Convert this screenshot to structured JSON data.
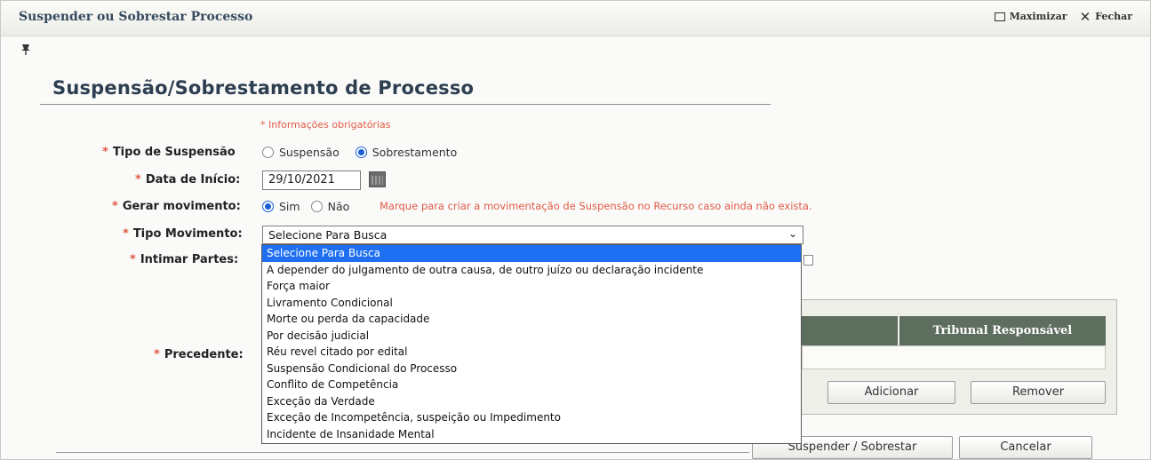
{
  "window": {
    "title": "Suspender ou Sobrestar Processo",
    "maximize_label": "Maximizar",
    "close_label": "Fechar"
  },
  "form": {
    "heading": "Suspensão/Sobrestamento de Processo",
    "required_note": "* Informações obrigatórias",
    "required_mark": "*",
    "tipo_suspensao": {
      "label": "Tipo de Suspensão",
      "options": [
        "Suspensão",
        "Sobrestamento"
      ],
      "selected": "Sobrestamento"
    },
    "data_inicio": {
      "label": "Data de Início:",
      "value": "29/10/2021"
    },
    "gerar_movimento": {
      "label": "Gerar movimento:",
      "options": [
        "Sim",
        "Não"
      ],
      "selected": "Sim",
      "hint": "Marque para criar a movimentação de Suspensão no Recurso caso ainda não exista."
    },
    "tipo_movimento": {
      "label": "Tipo Movimento:",
      "value": "Selecione Para Busca",
      "options": [
        "Selecione Para Busca",
        "A depender do julgamento de outra causa, de outro juízo ou declaração incidente",
        "Força maior",
        "Livramento Condicional",
        "Morte ou perda da capacidade",
        "Por decisão judicial",
        "Réu revel citado por edital",
        "Suspensão Condicional do Processo",
        "Conflito de Competência",
        "Exceção da Verdade",
        "Exceção de Incompetência, suspeição ou Impedimento",
        "Incidente de Insanidade Mental"
      ],
      "highlighted": "Selecione Para Busca"
    },
    "intimar_partes": {
      "label": "Intimar Partes:"
    },
    "precedente": {
      "label": "Precedente:",
      "table_header": "Tribunal Responsável",
      "add_label": "Adicionar",
      "remove_label": "Remover"
    }
  },
  "footer": {
    "submit_label": "Suspender / Sobrestar",
    "cancel_label": "Cancelar"
  },
  "colors": {
    "accent_red": "#e05a46",
    "radio_blue": "#1a5fd6",
    "selected_option_bg": "#1e6ff2",
    "table_header_bg": "#5d6e5f"
  }
}
